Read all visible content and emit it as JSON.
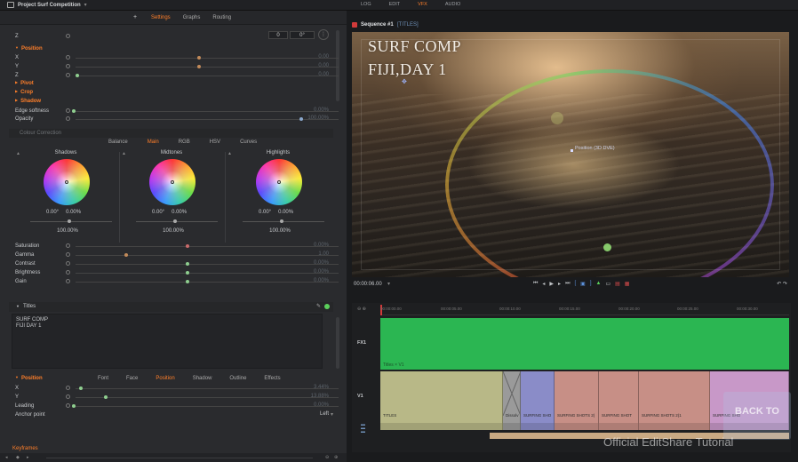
{
  "app": {
    "project_title": "Project Surf Competition",
    "modes": [
      "LOG",
      "EDIT",
      "VFX",
      "AUDIO"
    ],
    "active_mode": "VFX"
  },
  "left_panel": {
    "add_button": "+",
    "tabs": [
      "Settings",
      "Graphs",
      "Routing"
    ],
    "active_tab": "Settings",
    "z_row": {
      "label": "Z",
      "field1": "0",
      "field2": "0°"
    },
    "position_section": "Position",
    "position": [
      {
        "label": "X",
        "value": "0.00"
      },
      {
        "label": "Y",
        "value": "0.00"
      },
      {
        "label": "Z",
        "value": "0.00"
      }
    ],
    "pivot_section": "Pivot",
    "crop_section": "Crop",
    "shadow_section": "Shadow",
    "edge_softness": {
      "label": "Edge softness",
      "value": "0.00%"
    },
    "opacity": {
      "label": "Opacity",
      "value": "100.00%"
    },
    "colour_correction": {
      "header": "Colour Correction",
      "tabs": [
        "Balance",
        "Main",
        "RGB",
        "HSV",
        "Curves"
      ],
      "active_tab": "Main",
      "wheels": [
        {
          "title": "Shadows",
          "v1": "0.00°",
          "v2": "0.00%",
          "pct": "100.00%"
        },
        {
          "title": "Midtones",
          "v1": "0.00°",
          "v2": "0.00%",
          "pct": "100.00%"
        },
        {
          "title": "Highlights",
          "v1": "0.00°",
          "v2": "0.00%",
          "pct": "100.00%"
        }
      ],
      "sliders": [
        {
          "label": "Saturation",
          "value": "0.00%"
        },
        {
          "label": "Gamma",
          "value": "1.00"
        },
        {
          "label": "Contrast",
          "value": "0.00%"
        },
        {
          "label": "Brightness",
          "value": "0.00%"
        },
        {
          "label": "Gain",
          "value": "0.00%"
        }
      ]
    },
    "titles": {
      "header": "Titles",
      "text_line1": "SURF COMP",
      "text_line2": "FIJI DAY 1",
      "tabs": [
        "Font",
        "Face",
        "Position",
        "Shadow",
        "Outline",
        "Effects"
      ],
      "active_tab": "Position",
      "position_section": "Position",
      "x": {
        "label": "X",
        "value": "3.44%"
      },
      "y": {
        "label": "Y",
        "value": "13.88%"
      },
      "leading": {
        "label": "Leading",
        "value": "0.00%"
      },
      "anchor": {
        "label": "Anchor point",
        "value": "Left"
      }
    },
    "keyframes_label": "Keyframes"
  },
  "viewer": {
    "sequence_title": "Sequence #1",
    "sequence_tag": "[TITLES]",
    "overlay_line1": "SURF COMP",
    "overlay_line2": "FIJI,DAY 1",
    "position_label": "Position (3D DVE)",
    "timecode": "00:00:06.00"
  },
  "timeline": {
    "ruler_ticks": [
      "00:00:00.00",
      "00:00:05.00",
      "00:00:10.00",
      "00:00:15.00",
      "00:00:20.00",
      "00:00:25.00",
      "00:00:30.00"
    ],
    "fx_track_label": "FX1",
    "fx_clip_name": "Titles × V1",
    "video_track_label": "V1",
    "clips": [
      "TITLES",
      "Dissolv",
      "SURFING SHO",
      "SURFING SHOTS 2(",
      "SURFING SHOT",
      "SURFING SHOTS 2(1",
      "SURFING SHO"
    ],
    "watermark": "Official EditShare Tutorial",
    "back_to": "BACK TO"
  },
  "colors": {
    "accent": "#ff7f2a",
    "fx_clip": "#2bb652"
  }
}
